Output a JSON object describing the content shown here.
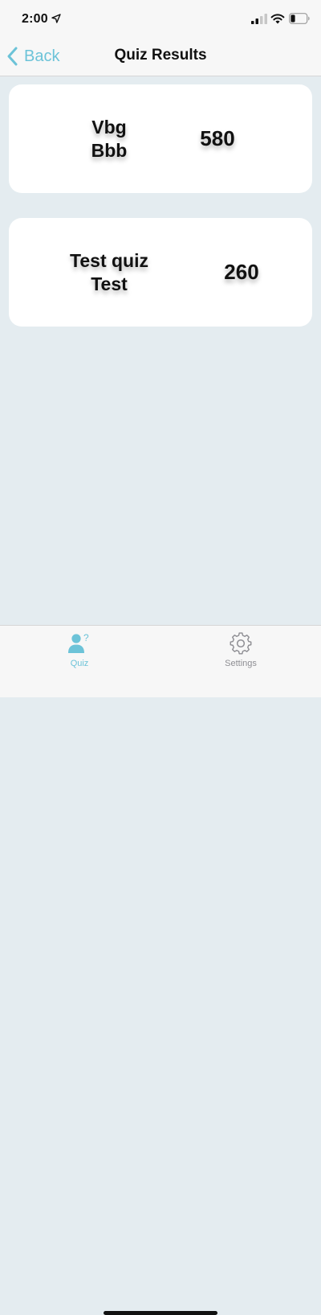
{
  "status_bar": {
    "time": "2:00"
  },
  "nav": {
    "back_label": "Back",
    "title": "Quiz Results"
  },
  "results": [
    {
      "name_line1": "Vbg",
      "name_line2": "Bbb",
      "score": "580"
    },
    {
      "name_line1": "Test quiz",
      "name_line2": "Test",
      "score": "260"
    }
  ],
  "tabs": [
    {
      "label": "Quiz",
      "icon": "user-question-icon",
      "active": true
    },
    {
      "label": "Settings",
      "icon": "gear-icon",
      "active": false
    }
  ],
  "colors": {
    "accent": "#6cc3d8",
    "background": "#e4ecf0",
    "card": "#ffffff",
    "inactive_tab": "#8e8e93"
  }
}
